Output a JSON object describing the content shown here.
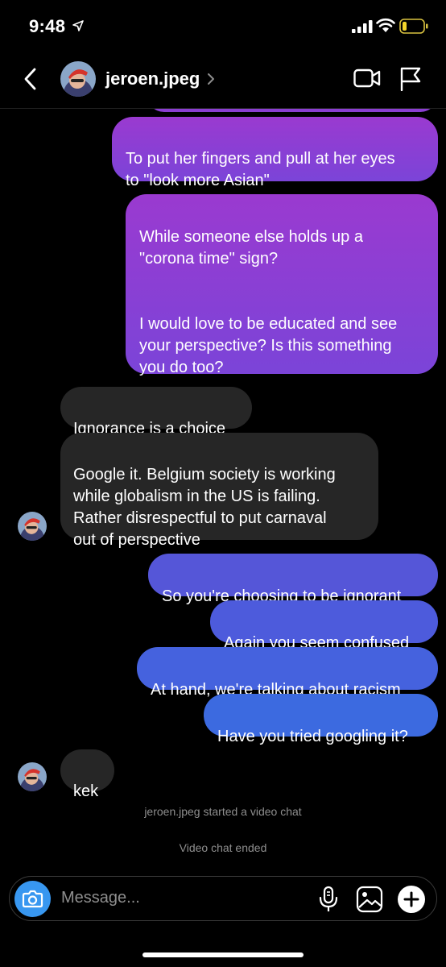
{
  "status_bar": {
    "time": "9:48"
  },
  "header": {
    "username": "jeroen.jpeg"
  },
  "messages": [
    {
      "from": "me",
      "text": "To put her fingers and pull at her eyes\nto \"look more Asian\""
    },
    {
      "from": "me",
      "text": "While someone else holds up a\n\"corona time\" sign?\n\n\nI would love to be educated and see\nyour perspective? Is this something\nyou do too?"
    },
    {
      "from": "them",
      "text": "Ignorance is a choice"
    },
    {
      "from": "them",
      "text": "Google it. Belgium society is working\nwhile globalism in the US is failing.\nRather disrespectful to put carnaval\nout of perspective"
    },
    {
      "from": "me",
      "text": "So you're choosing to be ignorant"
    },
    {
      "from": "me",
      "text": "Again you seem confused"
    },
    {
      "from": "me",
      "text": "At hand, we're talking about racism"
    },
    {
      "from": "me",
      "text": "Have you tried googling it?"
    },
    {
      "from": "them",
      "text": "kek"
    }
  ],
  "system_messages": [
    "jeroen.jpeg started a video chat",
    "Video chat ended"
  ],
  "composer": {
    "placeholder": "Message..."
  },
  "colors": {
    "outgoing_purple": "#8b3ed2",
    "outgoing_blue": "#4c5bdc",
    "incoming": "#262626",
    "accent_camera": "#3897f0"
  },
  "icons": [
    "location-arrow-icon",
    "signal-icon",
    "wifi-icon",
    "battery-icon",
    "back-icon",
    "chevron-right-icon",
    "video-call-icon",
    "flag-icon",
    "camera-icon",
    "microphone-icon",
    "gallery-icon",
    "plus-icon"
  ]
}
